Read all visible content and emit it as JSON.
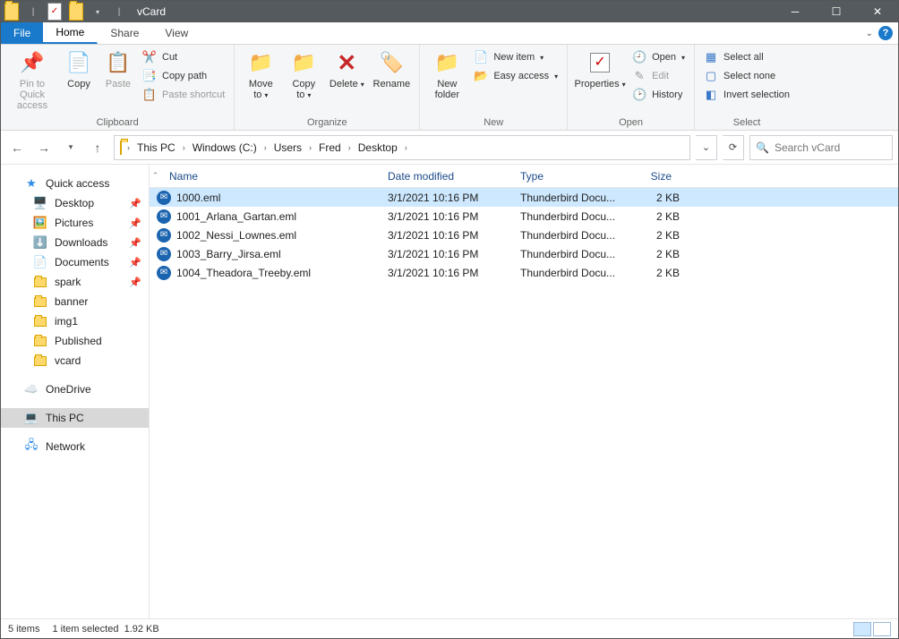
{
  "window": {
    "title": "vCard"
  },
  "tabs": {
    "file": "File",
    "home": "Home",
    "share": "Share",
    "view": "View"
  },
  "ribbon": {
    "clipboard": {
      "label": "Clipboard",
      "pinToQuick": "Pin to Quick access",
      "copy": "Copy",
      "paste": "Paste",
      "cut": "Cut",
      "copyPath": "Copy path",
      "pasteShortcut": "Paste shortcut"
    },
    "organize": {
      "label": "Organize",
      "moveTo": "Move to",
      "copyTo": "Copy to",
      "delete": "Delete",
      "rename": "Rename"
    },
    "new": {
      "label": "New",
      "newFolder": "New folder",
      "newItem": "New item",
      "easyAccess": "Easy access"
    },
    "open": {
      "label": "Open",
      "properties": "Properties",
      "openBtn": "Open",
      "edit": "Edit",
      "history": "History"
    },
    "select": {
      "label": "Select",
      "selectAll": "Select all",
      "selectNone": "Select none",
      "invert": "Invert selection"
    }
  },
  "breadcrumbs": [
    "This PC",
    "Windows (C:)",
    "Users",
    "Fred",
    "Desktop"
  ],
  "search": {
    "placeholder": "Search vCard"
  },
  "nav": {
    "quickAccess": "Quick access",
    "pinned": [
      "Desktop",
      "Pictures",
      "Downloads",
      "Documents",
      "spark"
    ],
    "folders": [
      "banner",
      "img1",
      "Published",
      "vcard"
    ],
    "oneDrive": "OneDrive",
    "thisPC": "This PC",
    "network": "Network"
  },
  "columns": {
    "name": "Name",
    "date": "Date modified",
    "type": "Type",
    "size": "Size"
  },
  "files": [
    {
      "name": "1000.eml",
      "date": "3/1/2021 10:16 PM",
      "type": "Thunderbird Docu...",
      "size": "2 KB",
      "selected": true
    },
    {
      "name": "1001_Arlana_Gartan.eml",
      "date": "3/1/2021 10:16 PM",
      "type": "Thunderbird Docu...",
      "size": "2 KB",
      "selected": false
    },
    {
      "name": "1002_Nessi_Lownes.eml",
      "date": "3/1/2021 10:16 PM",
      "type": "Thunderbird Docu...",
      "size": "2 KB",
      "selected": false
    },
    {
      "name": "1003_Barry_Jirsa.eml",
      "date": "3/1/2021 10:16 PM",
      "type": "Thunderbird Docu...",
      "size": "2 KB",
      "selected": false
    },
    {
      "name": "1004_Theadora_Treeby.eml",
      "date": "3/1/2021 10:16 PM",
      "type": "Thunderbird Docu...",
      "size": "2 KB",
      "selected": false
    }
  ],
  "status": {
    "count": "5 items",
    "selected": "1 item selected",
    "size": "1.92 KB"
  }
}
